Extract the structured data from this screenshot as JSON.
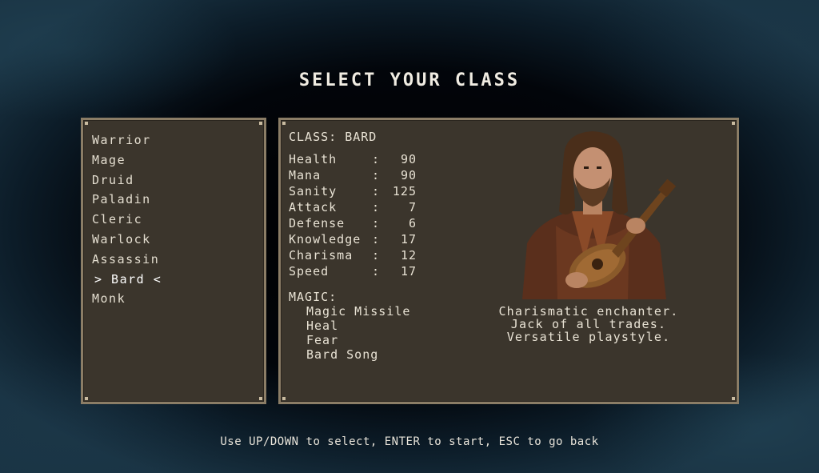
{
  "screen": {
    "title": "SELECT YOUR CLASS",
    "hint": "Use UP/DOWN to select, ENTER to start, ESC to go back"
  },
  "class_list": [
    {
      "label": "Warrior",
      "selected": false
    },
    {
      "label": "Mage",
      "selected": false
    },
    {
      "label": "Druid",
      "selected": false
    },
    {
      "label": "Paladin",
      "selected": false
    },
    {
      "label": "Cleric",
      "selected": false
    },
    {
      "label": "Warlock",
      "selected": false
    },
    {
      "label": "Assassin",
      "selected": false
    },
    {
      "label": "> Bard <",
      "selected": true
    },
    {
      "label": "Monk",
      "selected": false
    }
  ],
  "detail": {
    "class_heading": "CLASS: BARD",
    "stats": [
      {
        "name": "Health",
        "sep": ":",
        "value": "90"
      },
      {
        "name": "Mana",
        "sep": ":",
        "value": "90"
      },
      {
        "name": "Sanity",
        "sep": ":",
        "value": "125"
      },
      {
        "name": "Attack",
        "sep": ":",
        "value": "7"
      },
      {
        "name": "Defense",
        "sep": ":",
        "value": "6"
      },
      {
        "name": "Knowledge",
        "sep": ":",
        "value": "17"
      },
      {
        "name": "Charisma",
        "sep": ":",
        "value": "12"
      },
      {
        "name": "Speed",
        "sep": ":",
        "value": "17"
      }
    ],
    "magic_heading": "MAGIC:",
    "spells": [
      "Magic Missile",
      "Heal",
      "Fear",
      "Bard Song"
    ],
    "description": [
      "Charismatic enchanter.",
      "Jack of all trades.",
      "Versatile playstyle."
    ],
    "portrait_icon": "bard-portrait-icon"
  },
  "colors": {
    "panel_bg": "#3b352c",
    "panel_border": "#8b7d66",
    "text": "#e8e2d4",
    "background": "#000000"
  }
}
